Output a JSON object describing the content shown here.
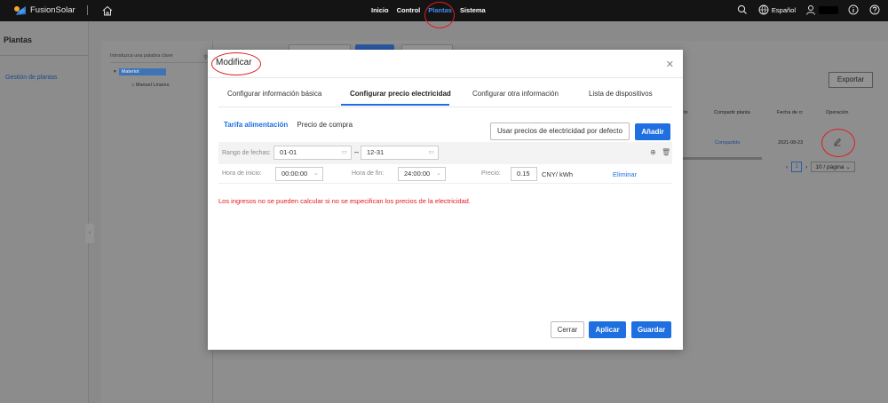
{
  "topbar": {
    "logo_text": "FusionSolar",
    "nav": [
      "Inicio",
      "Control",
      "Plantas",
      "Sistema"
    ],
    "language": "Español"
  },
  "sidebar": {
    "title": "Plantas",
    "items": [
      "Gestión de plantas"
    ]
  },
  "background": {
    "search_placeholder": "Introduzca una palabra clave",
    "tree": {
      "root": "Materiot",
      "child": "Manuel Linares"
    },
    "export_label": "Exportar",
    "columns": [
      "to",
      "Compartir planta",
      "Fecha de cr",
      "Operación"
    ],
    "row": {
      "share": "Compartido",
      "date": "2021-08-23"
    },
    "pager": {
      "page": "1",
      "page_size": "10 / página"
    }
  },
  "modal": {
    "title": "Modificar",
    "tabs": [
      "Configurar información básica",
      "Configurar precio electricidad",
      "Configurar otra información",
      "Lista de dispositivos"
    ],
    "subtabs": [
      "Tarifa alimentación",
      "Precio de compra"
    ],
    "default_prices_button": "Usar precios de electricidad por defecto",
    "add_button": "Añadir",
    "range": {
      "label": "Rango de fechas:",
      "start": "01-01",
      "end": "12-31",
      "separator": "–"
    },
    "time": {
      "start_label": "Hora de inicio:",
      "start": "00:00:00",
      "end_label": "Hora de fin:",
      "end": "24:00:00",
      "price_label": "Precio:",
      "price": "0.15",
      "unit": "CNY/ kWh",
      "delete_label": "Eliminar"
    },
    "warning": "Los ingresos no se pueden calcular si no se especifican los precios de la electricidad.",
    "footer": {
      "close": "Cerrar",
      "apply": "Aplicar",
      "save": "Guardar"
    }
  },
  "colors": {
    "accent": "#1f6fe0",
    "warning": "#e01b24",
    "topbar": "#141414",
    "annotation": "#e01b24"
  }
}
